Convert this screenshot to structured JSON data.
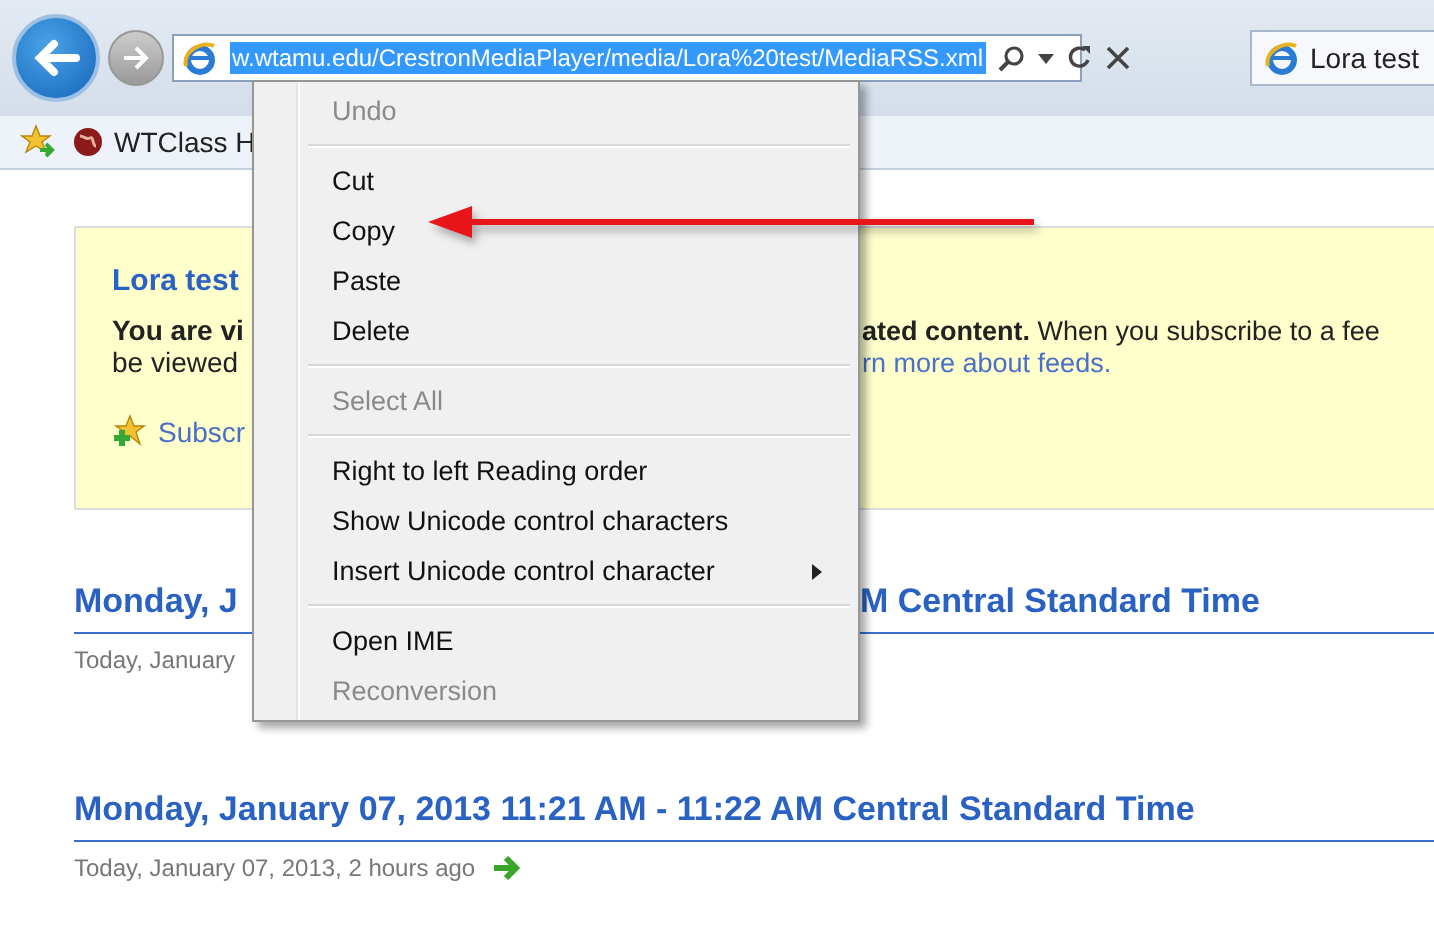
{
  "toolbar": {
    "address_bar": {
      "text": "w.wtamu.edu/CrestronMediaPlayer/media/Lora%20test/MediaRSS.xml",
      "selected": true
    },
    "tab": {
      "title": "Lora test"
    }
  },
  "favorites_bar": {
    "items": [
      {
        "label": "WTClass H"
      }
    ]
  },
  "feed_box": {
    "title": "Lora test",
    "notice_left": "You are vi",
    "notice_right": "**ated content.** When you subscribe to a fee",
    "line2_left": "be viewed",
    "line2_right_link": "rn more about feeds.",
    "subscribe_link": "Subscr"
  },
  "entries": [
    {
      "kind": "partial",
      "title_left": "Monday, J",
      "title_right": "M Central Standard Time",
      "date": "Today, January"
    },
    {
      "kind": "full",
      "title_left": "Monday, January 07, 2013 11:21 AM - 11:22 AM Central Standard Time",
      "date": "Today, January 07, 2013, 2 hours ago"
    }
  ],
  "context_menu": {
    "items": [
      {
        "kind": "item",
        "label": "Undo",
        "disabled": true,
        "submenu": false
      },
      {
        "kind": "separator"
      },
      {
        "kind": "item",
        "label": "Cut",
        "disabled": false,
        "submenu": false
      },
      {
        "kind": "item",
        "label": "Copy",
        "disabled": false,
        "submenu": false
      },
      {
        "kind": "item",
        "label": "Paste",
        "disabled": false,
        "submenu": false
      },
      {
        "kind": "item",
        "label": "Delete",
        "disabled": false,
        "submenu": false
      },
      {
        "kind": "separator"
      },
      {
        "kind": "item",
        "label": "Select All",
        "disabled": true,
        "submenu": false
      },
      {
        "kind": "separator"
      },
      {
        "kind": "item",
        "label": "Right to left Reading order",
        "disabled": false,
        "submenu": false
      },
      {
        "kind": "item",
        "label": "Show Unicode control characters",
        "disabled": false,
        "submenu": false
      },
      {
        "kind": "item",
        "label": "Insert Unicode control character",
        "disabled": false,
        "submenu": true
      },
      {
        "kind": "separator"
      },
      {
        "kind": "item",
        "label": "Open IME",
        "disabled": false,
        "submenu": false
      },
      {
        "kind": "item",
        "label": "Reconversion",
        "disabled": true,
        "submenu": false
      }
    ]
  }
}
